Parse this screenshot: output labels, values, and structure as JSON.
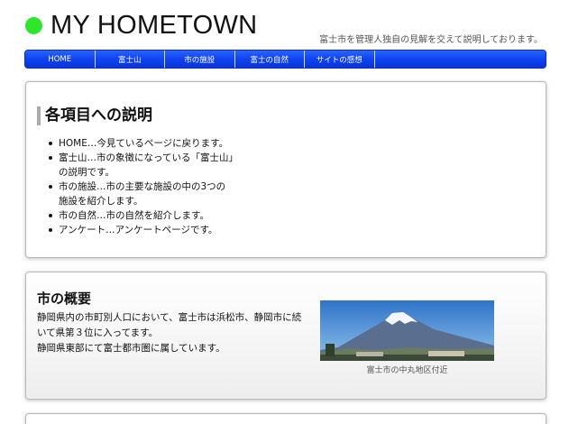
{
  "header": {
    "title": "MY HOMETOWN",
    "tagline": "富士市を管理人独自の見解を交えて説明しております。",
    "logo_color": "#2ee62e"
  },
  "nav": {
    "items": [
      {
        "label": "HOME"
      },
      {
        "label": "富士山"
      },
      {
        "label": "市の施設"
      },
      {
        "label": "富士の自然"
      },
      {
        "label": "サイトの感想"
      }
    ],
    "color": "#0e43f2"
  },
  "intro": {
    "heading": "各項目への説明",
    "items": [
      {
        "line1": "HOME…今見ているページに戻ります。",
        "line2": ""
      },
      {
        "line1": "富士山…市の象徴になっている「富士山」",
        "line2": "の説明です。"
      },
      {
        "line1": "市の施設…市の主要な施設の中の3つの",
        "line2": "施設を紹介します。"
      },
      {
        "line1": "市の自然…市の自然を紹介します。",
        "line2": ""
      },
      {
        "line1": "アンケート…アンケートページです。",
        "line2": ""
      }
    ]
  },
  "overview": {
    "heading": "市の概要",
    "lines": [
      "静岡県内の市町別人口において、富士市は浜松市、静岡市に続",
      "いて県第３位に入ってます。",
      "静岡県東部にて富士都市圏に属しています。"
    ],
    "photo_caption": "富士市の中丸地区付近"
  }
}
